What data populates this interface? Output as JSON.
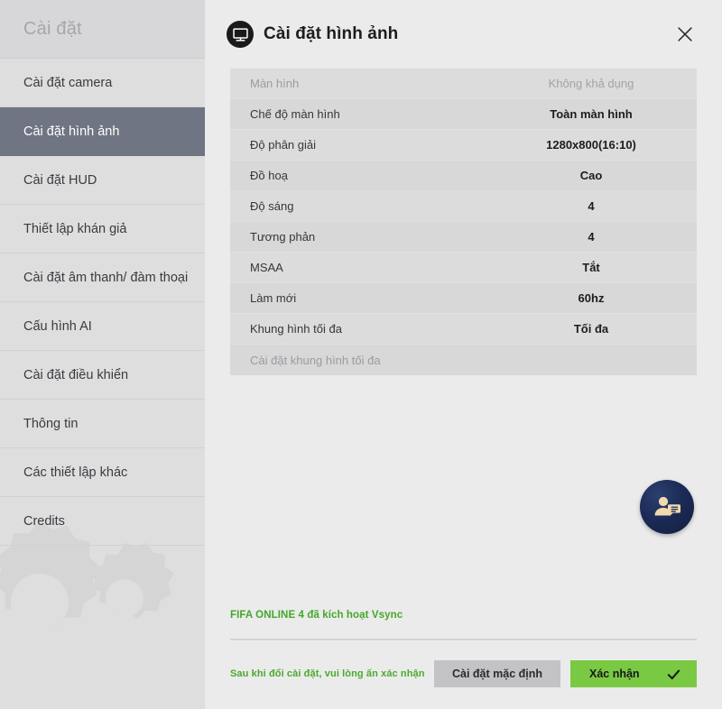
{
  "sidebar": {
    "header_label": "Cài đặt",
    "items": [
      {
        "label": "Cài đặt camera",
        "active": false
      },
      {
        "label": "Cài đặt hình ảnh",
        "active": true
      },
      {
        "label": "Cài đặt HUD",
        "active": false
      },
      {
        "label": "Thiết lập khán giả",
        "active": false
      },
      {
        "label": "Cài đặt âm thanh/ đàm thoại",
        "active": false
      },
      {
        "label": "Cấu hình AI",
        "active": false
      },
      {
        "label": "Cài đặt điều khiển",
        "active": false
      },
      {
        "label": "Thông tin",
        "active": false
      },
      {
        "label": "Các thiết lập khác",
        "active": false
      },
      {
        "label": "Credits",
        "active": false
      }
    ],
    "decoration_icon": "gears-icon"
  },
  "panel": {
    "title": "Cài đặt hình ảnh",
    "title_icon": "monitor-icon",
    "close_icon": "close-icon",
    "rows": [
      {
        "key": "Màn hình",
        "value": "Không khả dụng",
        "disabled": true
      },
      {
        "key": "Chế độ màn hình",
        "value": "Toàn màn hình",
        "disabled": false
      },
      {
        "key": "Độ phân giải",
        "value": "1280x800(16:10)",
        "disabled": false
      },
      {
        "key": "Đồ hoạ",
        "value": "Cao",
        "disabled": false
      },
      {
        "key": "Độ sáng",
        "value": "4",
        "disabled": false
      },
      {
        "key": "Tương phản",
        "value": "4",
        "disabled": false
      },
      {
        "key": "MSAA",
        "value": "Tắt",
        "disabled": false
      },
      {
        "key": "Làm mới",
        "value": "60hz",
        "disabled": false
      },
      {
        "key": "Khung hình tối đa",
        "value": "Tối đa",
        "disabled": false
      },
      {
        "key": "Cài đặt khung hình tối đa",
        "value": "",
        "disabled": true
      }
    ]
  },
  "help_fab": {
    "icon": "user-chat-icon"
  },
  "footer": {
    "vsync_note": "FIFA ONLINE 4 đã kích hoạt Vsync",
    "hint": "Sau khi đổi cài đặt, vui lòng ấn xác nhận",
    "default_button": "Cài đặt mặc định",
    "confirm_button": "Xác nhận",
    "confirm_icon": "check-icon"
  },
  "colors": {
    "accent_green": "#7ac943",
    "note_green": "#43a828",
    "sidebar_active": "#6f7582",
    "panel_bg": "#ebebeb",
    "sidebar_bg": "#dededf",
    "fab_navy": "#1b2a55"
  }
}
